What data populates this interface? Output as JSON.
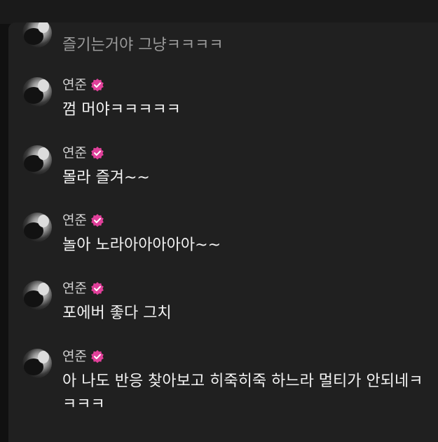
{
  "chat": {
    "partial_message": {
      "text": "즐기는거야 그냥ㅋㅋㅋㅋ"
    },
    "messages": [
      {
        "sender": "연준",
        "verified": true,
        "text": "껌 머야ㅋㅋㅋㅋㅋ"
      },
      {
        "sender": "연준",
        "verified": true,
        "text": "몰라 즐겨~~"
      },
      {
        "sender": "연준",
        "verified": true,
        "text": "놀아 노라아아아아아~~"
      },
      {
        "sender": "연준",
        "verified": true,
        "text": "포에버 좋다 그치"
      },
      {
        "sender": "연준",
        "verified": true,
        "text": "아 나도 반응 찾아보고 히죽히죽 하느라 멀티가 안되네ㅋㅋㅋㅋ"
      }
    ]
  },
  "colors": {
    "background": "#202020",
    "badge": "#e0409a",
    "text": "#f2f2f2",
    "name": "#cfcfcf"
  },
  "icons": {
    "verified": "verified-badge-icon",
    "avatar": "avatar-image"
  }
}
